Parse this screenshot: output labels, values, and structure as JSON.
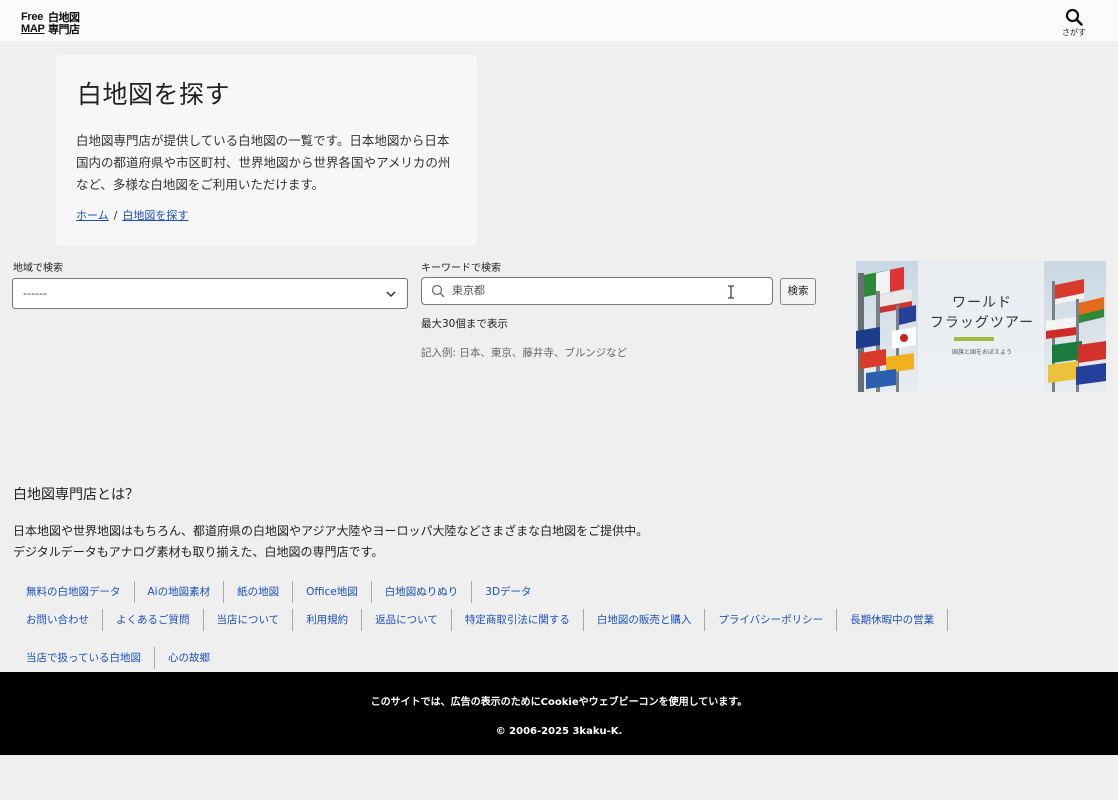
{
  "header": {
    "logo_free": "Free",
    "logo_map": "MAP",
    "logo_jp": "白地図専門店",
    "search_label": "さがす"
  },
  "hero": {
    "title": "白地図を探す",
    "description": "白地図専門店が提供している白地図の一覧です。日本地図から日本国内の都道府県や市区町村、世界地図から世界各国やアメリカの州など、多様な白地図をご利用いただけます。",
    "breadcrumb": {
      "home": "ホーム",
      "separator": "/",
      "current": "白地図を探す"
    }
  },
  "search": {
    "region_label": "地域で検索",
    "region_selected": "------",
    "keyword_label": "キーワードで検索",
    "keyword_placeholder": "東京都",
    "button_label": "検索",
    "max_note": "最大30個まで表示",
    "example": "記入例: 日本、東京、藤井寺、ブルンジなど"
  },
  "banner": {
    "title": "ワールド\nフラッグツアー",
    "subtitle": "国旗と国をおぼえよう"
  },
  "about": {
    "title": "白地図専門店とは？",
    "line1": "日本地図や世界地図はもちろん、都道府県の白地図やアジア大陸やヨーロッパ大陸などさまざまな白地図をご提供中。",
    "line2": "デジタルデータもアナログ素材も取り揃えた、白地図の専門店です。"
  },
  "nav_row1": [
    "無料の白地図データ",
    "Aiの地図素材",
    "紙の地図",
    "Office地図",
    "白地図ぬりぬり",
    "3Dデータ"
  ],
  "nav_row2": [
    "お問い合わせ",
    "よくあるご質問",
    "当店について",
    "利用規約",
    "返品について",
    "特定商取引法に関する",
    "白地図の販売と購入",
    "プライバシーポリシー",
    "長期休暇中の営業"
  ],
  "nav_row3": [
    "当店で扱っている白地図",
    "心の故郷"
  ],
  "footer": {
    "notice": "このサイトでは、広告の表示のためにCookieやウェブビーコンを使用しています。",
    "copyright": "© 2006-2025 3kaku-K."
  },
  "colors": {
    "link": "#1a4fc4",
    "footer_bg": "#000000",
    "page_bg": "#efefef",
    "banner_accent": "#9dbb3c"
  },
  "icons": [
    "search-icon",
    "chevron-down-icon",
    "text-cursor-icon"
  ]
}
